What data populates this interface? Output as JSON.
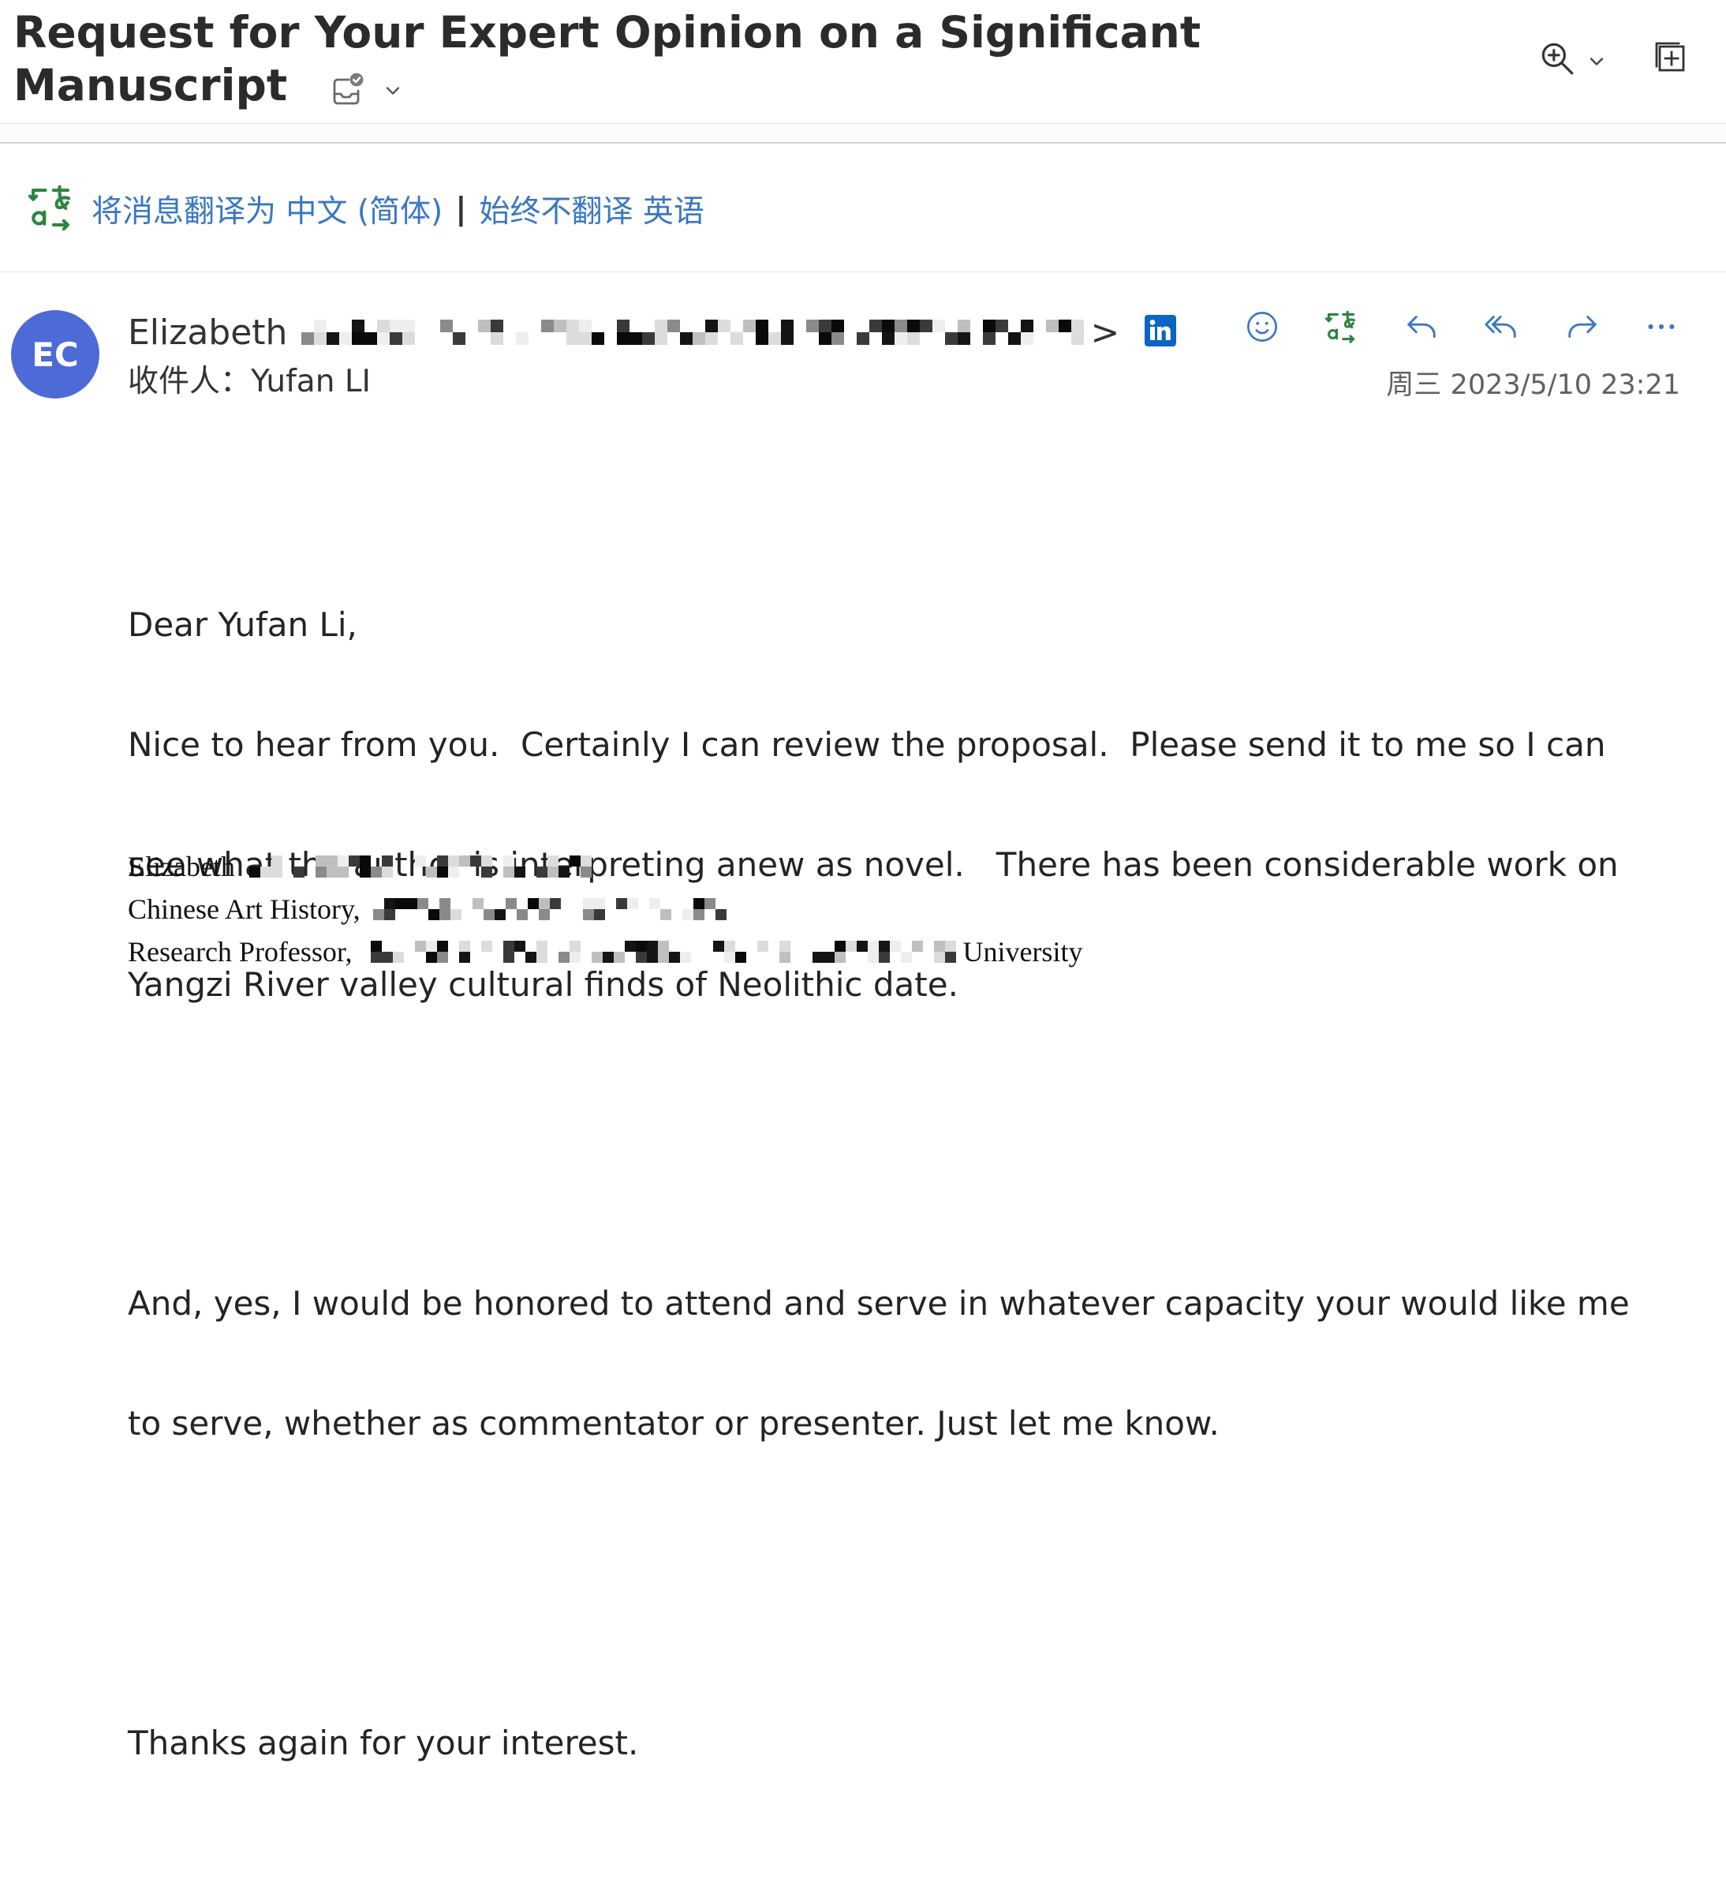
{
  "colors": {
    "link": "#3a77c4",
    "icon": "#3a77c4",
    "translate": "#2e8540",
    "avatar": "#4c6bd6",
    "linkedin": "#0a66c2",
    "text": "#242424",
    "muted": "#616161"
  },
  "subject": {
    "title": "Request for Your Expert Opinion on a Significant Manuscript",
    "summary_icon": "clipboard-check-icon",
    "summary_menu_icon": "chevron-down-icon"
  },
  "toolbar": {
    "zoom_icon": "zoom-in-icon",
    "zoom_menu_icon": "chevron-down-icon",
    "popout_icon": "open-in-new-window-icon"
  },
  "translate_bar": {
    "icon": "translate-icon",
    "translate_link": "将消息翻译为 中文 (简体)",
    "separator": "|",
    "never_translate_link": "始终不翻译 英语"
  },
  "message": {
    "avatar_initials": "EC",
    "sender": {
      "name_visible": "Elizabeth",
      "address_redacted": true,
      "address_end": ">",
      "linkedin_icon": "linkedin-icon"
    },
    "recipients": {
      "label": "收件人：",
      "value": "Yufan LI"
    },
    "date": "周三 2023/5/10 23:21",
    "actions": [
      {
        "icon": "emoji-smile-icon"
      },
      {
        "icon": "translate-icon"
      },
      {
        "icon": "reply-icon"
      },
      {
        "icon": "reply-all-icon"
      },
      {
        "icon": "forward-icon"
      },
      {
        "icon": "more-icon"
      }
    ]
  },
  "body": {
    "paragraphs": [
      [
        "Dear Yufan Li,",
        "Nice to hear from you.  Certainly I can review the proposal.  Please send it to me so I can",
        "see what the author is interpreting anew as novel.   There has been considerable work on",
        "Yangzi River valley cultural finds of Neolithic date."
      ],
      [
        "And, yes, I would be honored to attend and serve in whatever capacity your would like me",
        "to serve, whether as commentator or presenter. Just let me know."
      ],
      [
        "Thanks again for your interest."
      ]
    ]
  },
  "signature": {
    "lines": [
      {
        "lead": "Elizabeth",
        "redacted": true
      },
      {
        "lead": "Chinese Art History,",
        "redacted": true
      },
      {
        "lead": "Research Professor,",
        "redacted": true,
        "tail": "University"
      }
    ]
  }
}
